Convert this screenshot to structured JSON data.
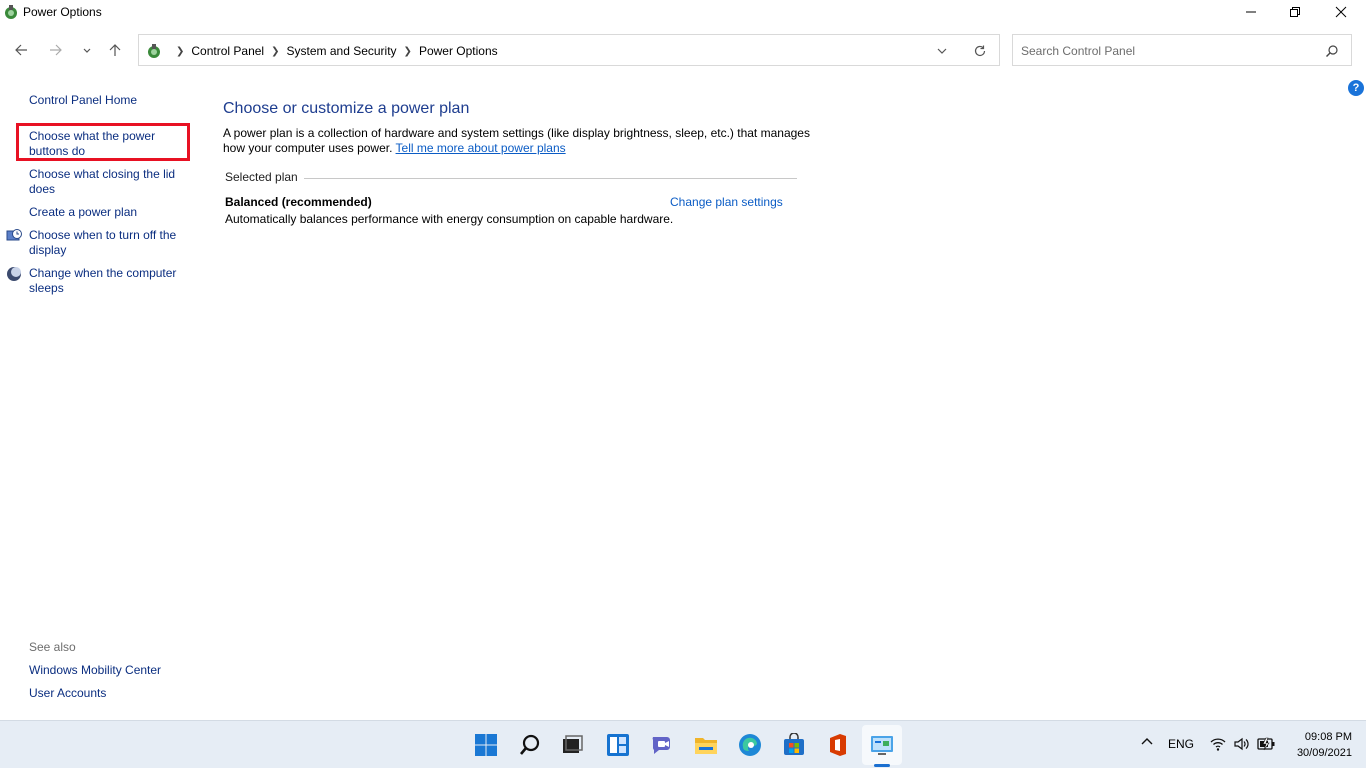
{
  "window": {
    "title": "Power Options"
  },
  "address_bar": {
    "crumbs": [
      "Control Panel",
      "System and Security",
      "Power Options"
    ]
  },
  "search": {
    "placeholder": "Search Control Panel"
  },
  "sidebar": {
    "home": "Control Panel Home",
    "links": [
      "Choose what the power buttons do",
      "Choose what closing the lid does",
      "Create a power plan",
      "Choose when to turn off the display",
      "Change when the computer sleeps"
    ],
    "see_also_title": "See also",
    "see_also": [
      "Windows Mobility Center",
      "User Accounts"
    ]
  },
  "main": {
    "heading": "Choose or customize a power plan",
    "description": "A power plan is a collection of hardware and system settings (like display brightness, sleep, etc.) that manages how your computer uses power.",
    "learn_more": "Tell me more about power plans",
    "selected_plan_label": "Selected plan",
    "plan_name": "Balanced (recommended)",
    "plan_description": "Automatically balances performance with energy consumption on capable hardware.",
    "change_plan_link": "Change plan settings"
  },
  "help_icon": "?",
  "taskbar": {
    "language": "ENG",
    "time": "09:08 PM",
    "date": "30/09/2021"
  },
  "colors": {
    "link": "#0b2e80",
    "heading": "#1e3d8f",
    "highlight": "#e81123",
    "taskbar": "#e6edf5"
  }
}
